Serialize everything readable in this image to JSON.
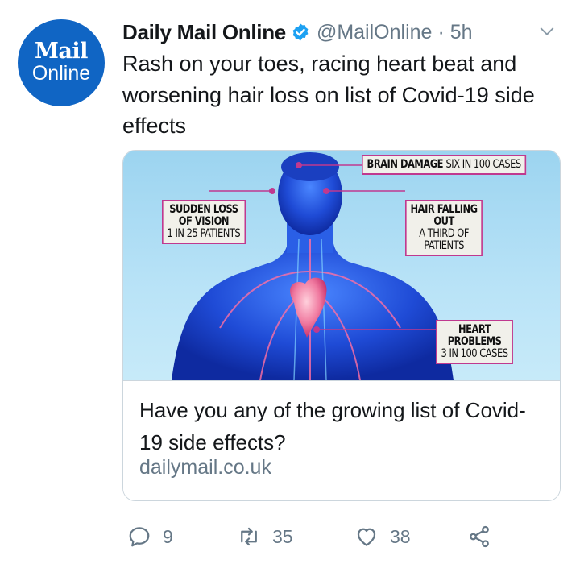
{
  "account": {
    "display_name": "Daily Mail Online",
    "handle": "@MailOnline",
    "separator": "·",
    "time": "5h",
    "avatar_top": "Mail",
    "avatar_bottom": "Online",
    "verified": true
  },
  "tweet": {
    "text": "Rash on your toes, racing heart beat and worsening hair loss on list of Covid-19 side effects"
  },
  "card": {
    "image_callouts": {
      "brain": {
        "bold": "BRAIN DAMAGE",
        "normal": "SIX IN 100 CASES"
      },
      "vision": {
        "line1": "SUDDEN LOSS",
        "line2": "OF VISION",
        "normal": "1 IN 25 PATIENTS"
      },
      "hair": {
        "line1": "HAIR FALLING",
        "line2": "OUT",
        "normal1": "A THIRD OF",
        "normal2": "PATIENTS"
      },
      "heart": {
        "line1": "HEART",
        "line2": "PROBLEMS",
        "normal": "3 IN 100 CASES"
      }
    },
    "title": "Have you any of the growing list of Covid-19 side effects?",
    "domain": "dailymail.co.uk"
  },
  "actions": {
    "reply_count": "9",
    "retweet_count": "35",
    "like_count": "38"
  },
  "colors": {
    "avatar_bg": "#1065c4",
    "verified_blue": "#1da1f2",
    "secondary_text": "#657786",
    "callout_border": "#c0398f",
    "card_border": "#ccd6dd"
  },
  "icons": [
    "verified-badge-icon",
    "chevron-down-icon",
    "reply-icon",
    "retweet-icon",
    "like-icon",
    "share-icon"
  ]
}
